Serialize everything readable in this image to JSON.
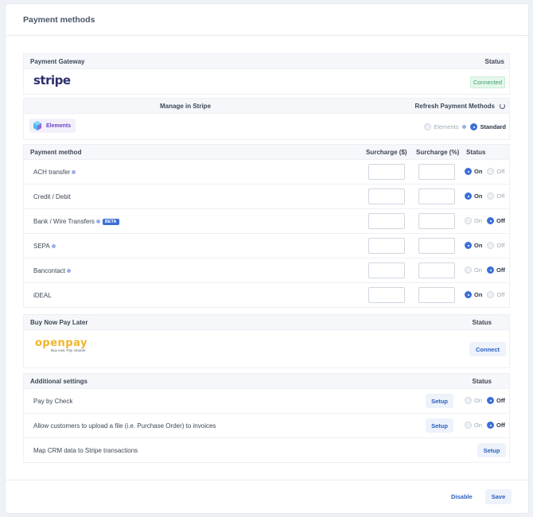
{
  "header": {
    "title": "Payment methods"
  },
  "gateway": {
    "label": "Payment Gateway",
    "status_label": "Status",
    "logo_text": "stripe",
    "status": "Connected"
  },
  "manage": {
    "link": "Manage in Stripe",
    "refresh": "Refresh Payment Methods",
    "pill": "Elements",
    "options": [
      "Elements",
      "Standard"
    ],
    "selected": "Standard"
  },
  "methods": {
    "headers": {
      "method": "Payment method",
      "surcharge_d": "Surcharge ($)",
      "surcharge_p": "Surcharge (%)",
      "status": "Status"
    },
    "on_label": "On",
    "off_label": "Off",
    "beta_label": "BETA",
    "rows": [
      {
        "name": "ACH transfer",
        "info": true,
        "beta": false,
        "enabled": true
      },
      {
        "name": "Credit / Debit",
        "info": false,
        "beta": false,
        "enabled": true
      },
      {
        "name": "Bank / Wire Transfers",
        "info": true,
        "beta": true,
        "enabled": false
      },
      {
        "name": "SEPA",
        "info": true,
        "beta": false,
        "enabled": true
      },
      {
        "name": "Bancontact",
        "info": true,
        "beta": false,
        "enabled": false
      },
      {
        "name": "iDEAL",
        "info": false,
        "beta": false,
        "enabled": true
      }
    ]
  },
  "bnpl": {
    "label": "Buy Now Pay Later",
    "status_label": "Status",
    "logo_text": "openpay",
    "tagline": "Buy now. Pay smarter.",
    "connect": "Connect"
  },
  "additional": {
    "label": "Additional settings",
    "status_label": "Status",
    "setup_label": "Setup",
    "rows": [
      {
        "name": "Pay by Check",
        "enabled": false,
        "toggle": true
      },
      {
        "name": "Allow customers to upload a file (i.e. Purchase Order) to invoices",
        "enabled": false,
        "toggle": true
      },
      {
        "name": "Map CRM data to Stripe transactions",
        "toggle": false
      }
    ]
  },
  "footer": {
    "disable": "Disable",
    "save": "Save"
  },
  "colors": {
    "accent": "#3b6fd8",
    "connected": "#38a169",
    "openpay": "#f0b429"
  }
}
